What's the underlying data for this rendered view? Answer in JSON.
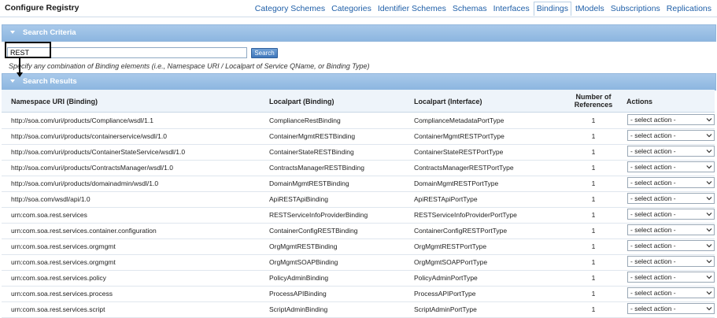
{
  "header": {
    "title": "Configure Registry",
    "tabs": [
      "Category Schemes",
      "Categories",
      "Identifier Schemes",
      "Schemas",
      "Interfaces",
      "Bindings",
      "tModels",
      "Subscriptions",
      "Replications"
    ],
    "active_tab": "Bindings"
  },
  "criteria": {
    "title": "Search Criteria",
    "input_value": "REST",
    "button_label": "Search",
    "hint": "Specify any combination of Binding elements (i.e., Namespace URI / Localpart of Service QName, or Binding Type)"
  },
  "results": {
    "title": "Search Results",
    "columns": {
      "namespace": "Namespace URI (Binding)",
      "localpart_binding": "Localpart (Binding)",
      "localpart_interface": "Localpart (Interface)",
      "refs_line1": "Number of",
      "refs_line2": "References",
      "actions": "Actions"
    },
    "select_placeholder": "- select action -",
    "rows": [
      {
        "ns": "http://soa.com/uri/products/Compliance/wsdl/1.1",
        "binding": "ComplianceRestBinding",
        "iface": "ComplianceMetadataPortType",
        "refs": "1"
      },
      {
        "ns": "http://soa.com/uri/products/containerservice/wsdl/1.0",
        "binding": "ContainerMgmtRESTBinding",
        "iface": "ContainerMgmtRESTPortType",
        "refs": "1"
      },
      {
        "ns": "http://soa.com/uri/products/ContainerStateService/wsdl/1.0",
        "binding": "ContainerStateRESTBinding",
        "iface": "ContainerStateRESTPortType",
        "refs": "1"
      },
      {
        "ns": "http://soa.com/uri/products/ContractsManager/wsdl/1.0",
        "binding": "ContractsManagerRESTBinding",
        "iface": "ContractsManagerRESTPortType",
        "refs": "1"
      },
      {
        "ns": "http://soa.com/uri/products/domainadmin/wsdl/1.0",
        "binding": "DomainMgmtRESTBinding",
        "iface": "DomainMgmtRESTPortType",
        "refs": "1"
      },
      {
        "ns": "http://soa.com/wsdl/api/1.0",
        "binding": "ApiRESTApiBinding",
        "iface": "ApiRESTApiPortType",
        "refs": "1"
      },
      {
        "ns": "urn:com.soa.rest.services",
        "binding": "RESTServiceInfoProviderBinding",
        "iface": "RESTServiceInfoProviderPortType",
        "refs": "1"
      },
      {
        "ns": "urn:com.soa.rest.services.container.configuration",
        "binding": "ContainerConfigRESTBinding",
        "iface": "ContainerConfigRESTPortType",
        "refs": "1"
      },
      {
        "ns": "urn:com.soa.rest.services.orgmgmt",
        "binding": "OrgMgmtRESTBinding",
        "iface": "OrgMgmtRESTPortType",
        "refs": "1"
      },
      {
        "ns": "urn:com.soa.rest.services.orgmgmt",
        "binding": "OrgMgmtSOAPBinding",
        "iface": "OrgMgmtSOAPPortType",
        "refs": "1"
      },
      {
        "ns": "urn:com.soa.rest.services.policy",
        "binding": "PolicyAdminBinding",
        "iface": "PolicyAdminPortType",
        "refs": "1"
      },
      {
        "ns": "urn:com.soa.rest.services.process",
        "binding": "ProcessAPIBinding",
        "iface": "ProcessAPIPortType",
        "refs": "1"
      },
      {
        "ns": "urn:com.soa.rest.services.script",
        "binding": "ScriptAdminBinding",
        "iface": "ScriptAdminPortType",
        "refs": "1"
      }
    ]
  }
}
